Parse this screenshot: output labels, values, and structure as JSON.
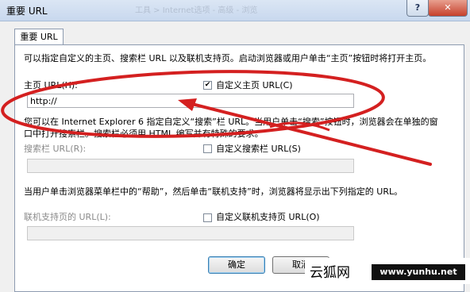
{
  "window": {
    "title": "重要 URL",
    "ghost_text": "工具 > Internet选项 - 高级 - 浏览",
    "help_label": "?",
    "close_label": "✕"
  },
  "tab": {
    "label": "重要 URL"
  },
  "intro": "可以指定自定义的主页、搜索栏 URL 以及联机支持页。启动浏览器或用户单击“主页”按钮时将打开主页。",
  "homepage": {
    "label": "主页 URL(H):",
    "custom_label": "自定义主页 URL(C)",
    "custom_checked": true,
    "value": "http://"
  },
  "search": {
    "description": "您可以在 Internet Explorer 6 指定自定义“搜索”栏 URL。当用户单击“搜索”按钮时，浏览器会在单独的窗口中打开搜索栏。搜索栏必须用 HTML 编写并有特殊的要求。",
    "label": "搜索栏 URL(R):",
    "custom_label": "自定义搜索栏 URL(S)",
    "custom_checked": false,
    "value": ""
  },
  "support": {
    "description": "当用户单击浏览器菜单栏中的“帮助”，然后单击“联机支持”时，浏览器将显示出下列指定的 URL。",
    "label": "联机支持页的 URL(L):",
    "custom_label": "自定义联机支持页 URL(O)",
    "custom_checked": false,
    "value": ""
  },
  "buttons": {
    "ok": "确定",
    "cancel": "取消"
  },
  "watermark": {
    "brand": "云狐网",
    "url": "www.yunhu.net"
  },
  "annotation": {
    "color": "#d42020"
  }
}
